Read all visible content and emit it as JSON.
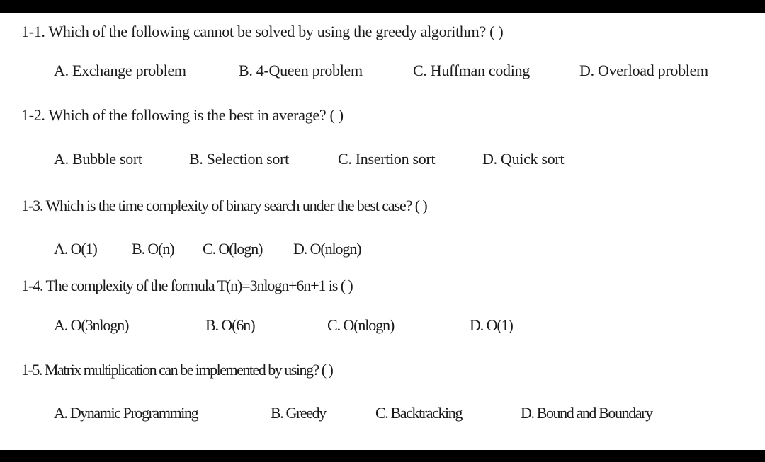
{
  "questions": [
    {
      "number": "1-1.",
      "text": "Which of the following cannot be solved by using the greedy algorithm?",
      "blank": "(      )",
      "options": [
        "A. Exchange problem",
        "B. 4-Queen problem",
        "C. Huffman coding",
        "D. Overload problem"
      ]
    },
    {
      "number": "1-2.",
      "text": "Which of the following is the best in average?",
      "blank": "(      )",
      "options": [
        "A. Bubble sort",
        "B. Selection sort",
        "C. Insertion sort",
        "D. Quick sort"
      ]
    },
    {
      "number": "1-3.",
      "text": "Which is the time complexity of binary search under the best case?",
      "blank": "(     )",
      "options": [
        "A. O(1)",
        "B. O(n)",
        "C. O(logn)",
        "D. O(nlogn)"
      ]
    },
    {
      "number": "1-4.",
      "text": "The complexity of the formula T(n)=3nlogn+6n+1 is",
      "blank": "(     )",
      "options": [
        "A. O(3nlogn)",
        "B. O(6n)",
        "C. O(nlogn)",
        "D. O(1)"
      ]
    },
    {
      "number": "1-5.",
      "text": "Matrix multiplication can be implemented by using?",
      "blank": "(      )",
      "options": [
        "A. Dynamic Programming",
        "B. Greedy",
        "C. Backtracking",
        "D. Bound and Boundary"
      ]
    }
  ]
}
